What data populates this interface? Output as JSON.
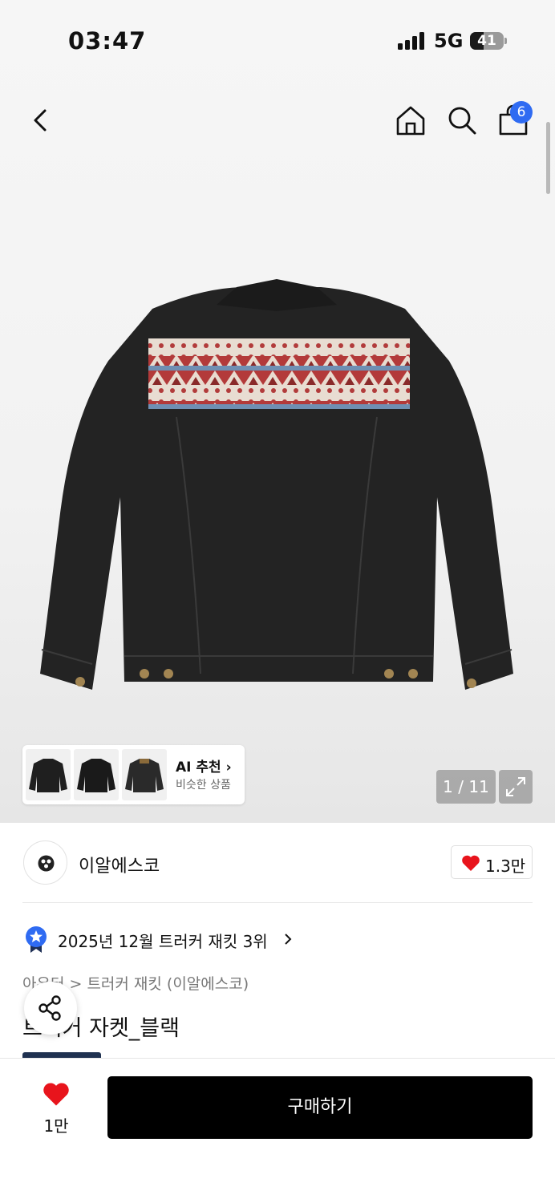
{
  "status_bar": {
    "time": "03:47",
    "network": "5G",
    "battery": "41",
    "battery_fraction": 0.41
  },
  "header": {
    "cart_count": "6"
  },
  "gallery": {
    "ai_title": "AI 추천",
    "ai_subtitle": "비슷한 상품",
    "pager": "1 / 11"
  },
  "brand": {
    "name": "이알에스코",
    "likes": "1.3만"
  },
  "ranking": {
    "text": "2025년 12월 트러커 재킷 3위"
  },
  "breadcrumb": {
    "text": "아우터 > 트러커 재킷 (이알에스코)"
  },
  "product": {
    "title": "트러커 자켓_블랙"
  },
  "bottom_bar": {
    "wish_count": "1만",
    "buy_label": "구매하기"
  },
  "colors": {
    "accent_blue": "#2f6bf2",
    "heart_red": "#e8141c",
    "buy_button": "#000000"
  }
}
